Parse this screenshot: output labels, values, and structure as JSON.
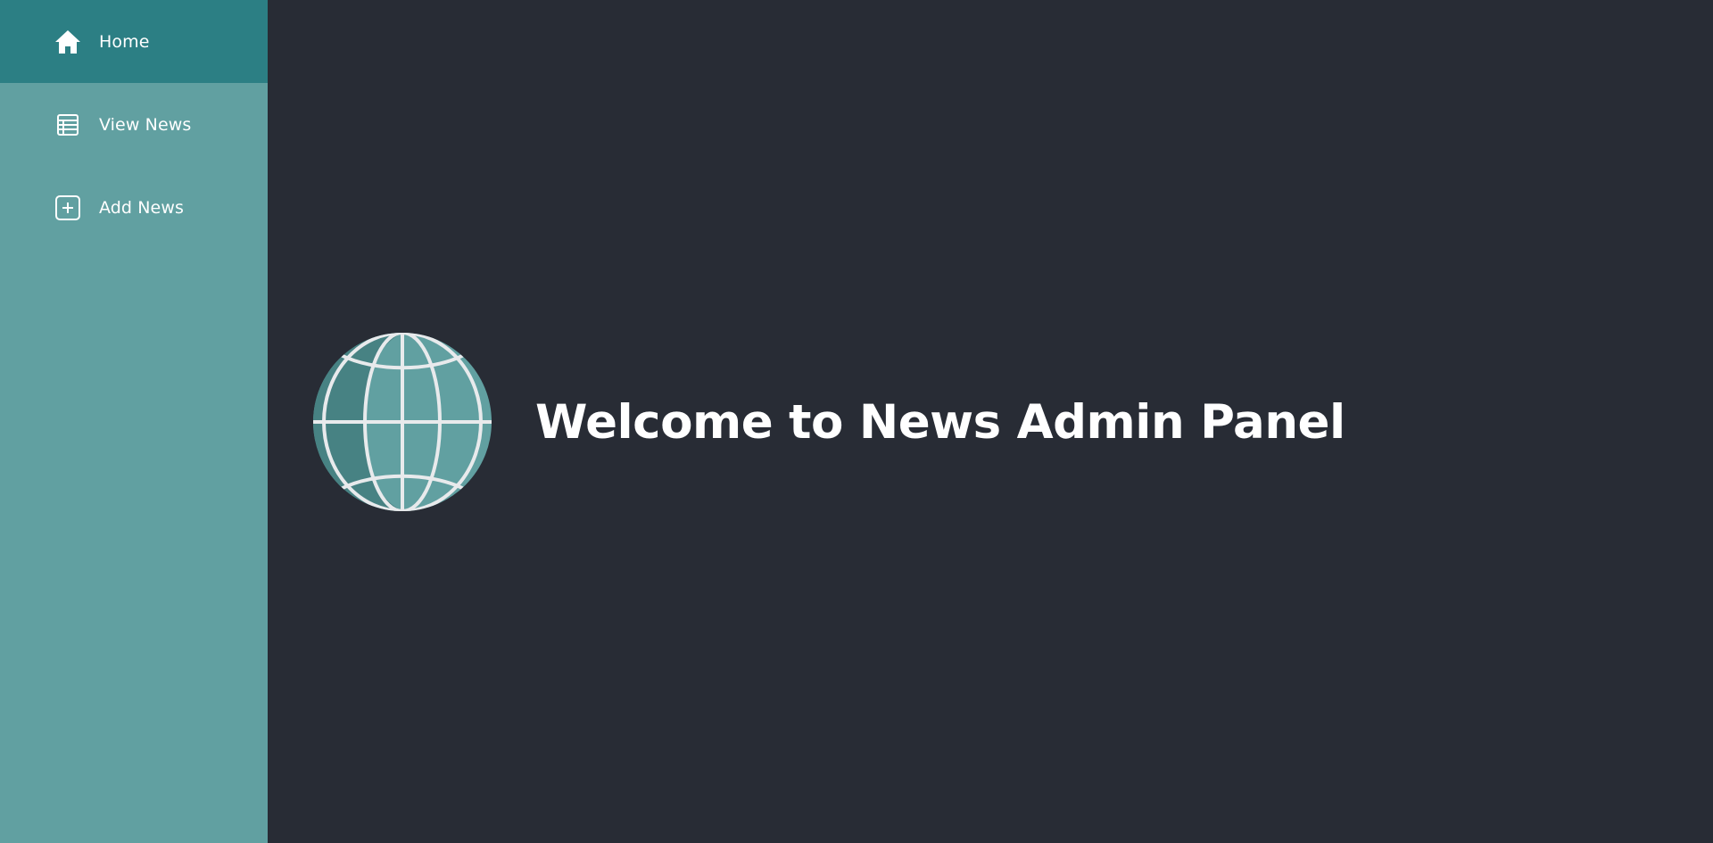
{
  "sidebar": {
    "items": [
      {
        "label": "Home",
        "icon": "home-icon",
        "active": true
      },
      {
        "label": "View News",
        "icon": "list-icon",
        "active": false
      },
      {
        "label": "Add News",
        "icon": "plus-square-icon",
        "active": false
      }
    ]
  },
  "main": {
    "logo_icon": "globe-icon",
    "welcome_text": "Welcome to News Admin Panel"
  },
  "colors": {
    "sidebar_bg": "#61a0a1",
    "sidebar_active_bg": "#2c7f84",
    "main_bg": "#282c35",
    "text": "#ffffff"
  }
}
